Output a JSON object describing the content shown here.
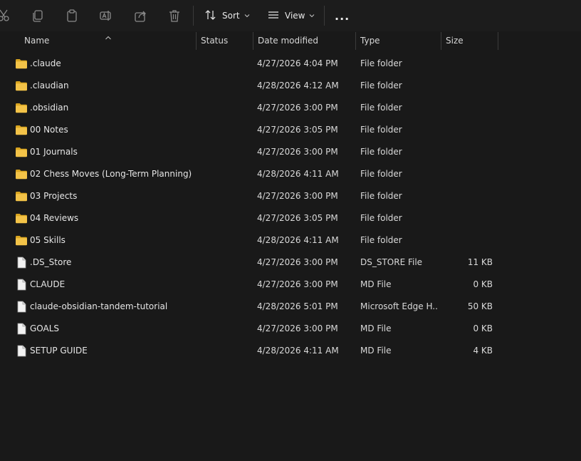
{
  "toolbar": {
    "icons": [
      "cut-icon",
      "copy-icon",
      "paste-icon",
      "rename-icon",
      "share-icon",
      "delete-icon"
    ],
    "sort_label": "Sort",
    "view_label": "View",
    "more_label": "..."
  },
  "columns": {
    "name": "Name",
    "status": "Status",
    "date": "Date modified",
    "type": "Type",
    "size": "Size"
  },
  "files": [
    {
      "name": ".claude",
      "date": "4/27/2026 4:04 PM",
      "type": "File folder",
      "size": "",
      "kind": "folder"
    },
    {
      "name": ".claudian",
      "date": "4/28/2026 4:12 AM",
      "type": "File folder",
      "size": "",
      "kind": "folder"
    },
    {
      "name": ".obsidian",
      "date": "4/27/2026 3:00 PM",
      "type": "File folder",
      "size": "",
      "kind": "folder"
    },
    {
      "name": "00 Notes",
      "date": "4/27/2026 3:05 PM",
      "type": "File folder",
      "size": "",
      "kind": "folder"
    },
    {
      "name": "01 Journals",
      "date": "4/27/2026 3:00 PM",
      "type": "File folder",
      "size": "",
      "kind": "folder"
    },
    {
      "name": "02 Chess Moves (Long-Term Planning)",
      "date": "4/28/2026 4:11 AM",
      "type": "File folder",
      "size": "",
      "kind": "folder"
    },
    {
      "name": "03 Projects",
      "date": "4/27/2026 3:00 PM",
      "type": "File folder",
      "size": "",
      "kind": "folder"
    },
    {
      "name": "04 Reviews",
      "date": "4/27/2026 3:05 PM",
      "type": "File folder",
      "size": "",
      "kind": "folder"
    },
    {
      "name": "05 Skills",
      "date": "4/28/2026 4:11 AM",
      "type": "File folder",
      "size": "",
      "kind": "folder"
    },
    {
      "name": ".DS_Store",
      "date": "4/27/2026 3:00 PM",
      "type": "DS_STORE File",
      "size": "11 KB",
      "kind": "file"
    },
    {
      "name": "CLAUDE",
      "date": "4/27/2026 3:00 PM",
      "type": "MD File",
      "size": "0 KB",
      "kind": "file"
    },
    {
      "name": "claude-obsidian-tandem-tutorial",
      "date": "4/28/2026 5:01 PM",
      "type": "Microsoft Edge H...",
      "size": "50 KB",
      "kind": "file"
    },
    {
      "name": "GOALS",
      "date": "4/27/2026 3:00 PM",
      "type": "MD File",
      "size": "0 KB",
      "kind": "file"
    },
    {
      "name": "SETUP GUIDE",
      "date": "4/28/2026 4:11 AM",
      "type": "MD File",
      "size": "4 KB",
      "kind": "file"
    }
  ],
  "colors": {
    "background": "#191919",
    "folder": "#f3c348",
    "text": "#e6e6e6"
  }
}
